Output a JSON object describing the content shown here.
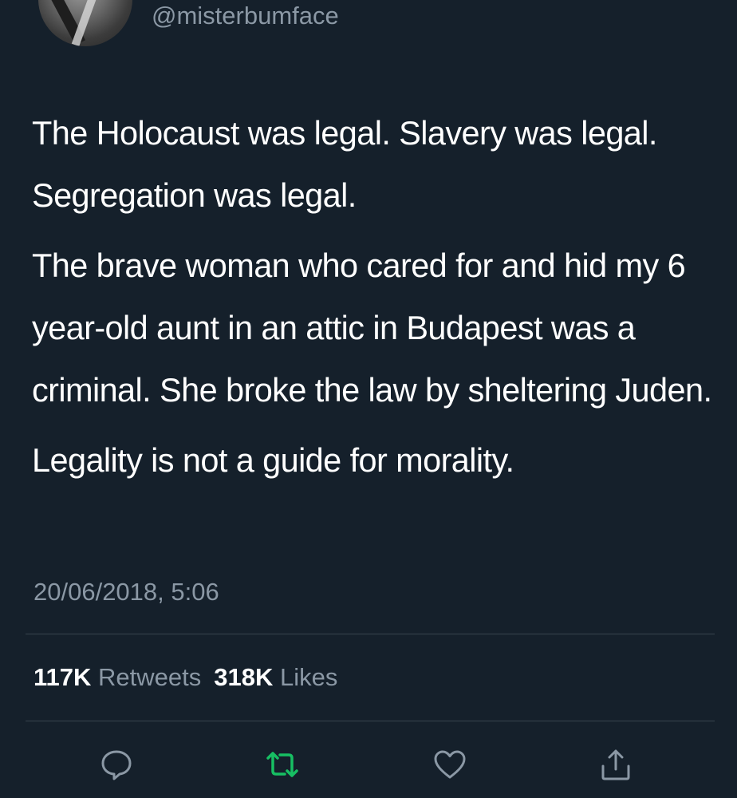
{
  "tweet": {
    "handle": "@misterbumface",
    "paragraphs": [
      "The Holocaust was legal. Slavery was legal. Segregation was legal.",
      "The brave woman who cared for and hid my 6 year-old aunt in an attic in Budapest was a criminal. She broke the law by sheltering Juden.",
      "Legality is not a guide for morality."
    ],
    "timestamp": "20/06/2018, 5:06"
  },
  "stats": {
    "retweets_count": "117K",
    "retweets_label": "Retweets",
    "likes_count": "318K",
    "likes_label": "Likes"
  },
  "actions": {
    "reply_icon": "reply-icon",
    "retweet_icon": "retweet-icon",
    "like_icon": "heart-icon",
    "share_icon": "share-icon"
  },
  "colors": {
    "background": "#15202b",
    "text": "#ffffff",
    "secondary_text": "#8b98a5",
    "divider": "#38444d",
    "retweet_accent": "#17bf63"
  }
}
